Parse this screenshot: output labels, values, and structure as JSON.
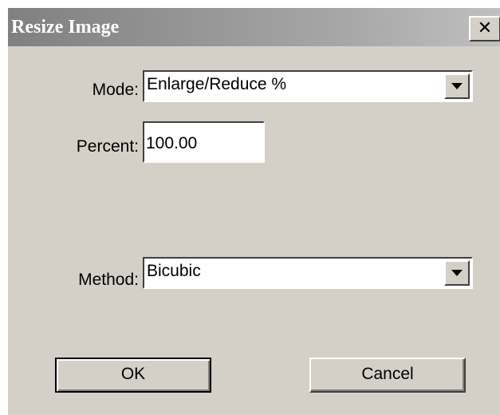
{
  "dialog": {
    "title": "Resize Image",
    "close_symbol": "✕",
    "close_icon": "close-icon"
  },
  "form": {
    "mode_label": "Mode:",
    "mode_value": "Enlarge/Reduce %",
    "percent_label": "Percent:",
    "percent_value": "100.00",
    "method_label": "Method:",
    "method_value": "Bicubic"
  },
  "buttons": {
    "ok_label": "OK",
    "cancel_label": "Cancel"
  }
}
